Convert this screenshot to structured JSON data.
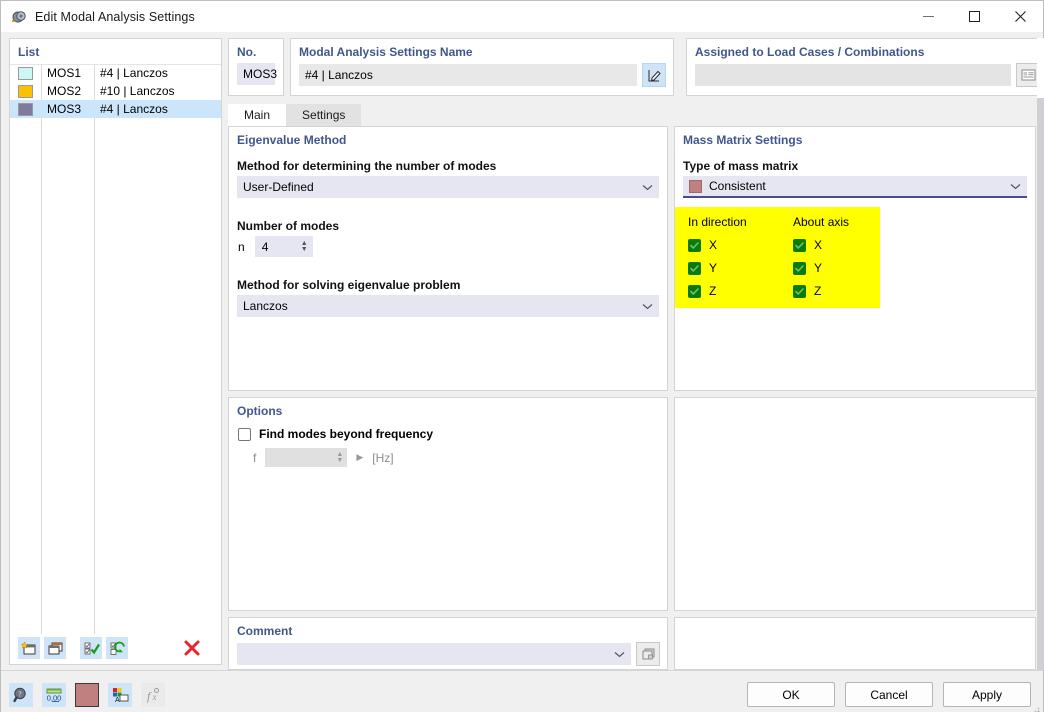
{
  "window": {
    "title": "Edit Modal Analysis Settings",
    "icon": "modal-analysis-icon",
    "minimize": "—",
    "maximize": "□",
    "close": "✕"
  },
  "list_panel": {
    "title": "List",
    "columns": [
      "color",
      "no",
      "description"
    ],
    "rows": [
      {
        "color": "#cdf6f7",
        "no": "MOS1",
        "description": "#4 | Lanczos",
        "selected": false
      },
      {
        "color": "#fbc002",
        "no": "MOS2",
        "description": "#10 | Lanczos",
        "selected": false
      },
      {
        "color": "#7f7a9e",
        "no": "MOS3",
        "description": "#4 | Lanczos",
        "selected": true
      }
    ],
    "toolbar": [
      {
        "name": "new-item-button",
        "title": "New"
      },
      {
        "name": "copy-item-button",
        "title": "Copy"
      },
      {
        "name": "select-all-button",
        "title": "Select All"
      },
      {
        "name": "invert-selection-button",
        "title": "Invert Selection"
      },
      {
        "name": "delete-item-button",
        "title": "Delete"
      }
    ]
  },
  "header": {
    "no_label": "No.",
    "no_value": "MOS3",
    "name_label": "Modal Analysis Settings Name",
    "name_value": "#4 | Lanczos",
    "name_edit_button": "edit-name-icon",
    "assigned_label": "Assigned to Load Cases / Combinations",
    "assigned_value": "",
    "assigned_button": "list-picker-icon"
  },
  "tabs": [
    {
      "label": "Main",
      "active": true
    },
    {
      "label": "Settings",
      "active": false
    }
  ],
  "eigenvalue_method": {
    "title": "Eigenvalue Method",
    "method_modes_label": "Method for determining the number of modes",
    "method_modes_value": "User-Defined",
    "number_of_modes_label": "Number of modes",
    "n_label": "n",
    "n_value": "4",
    "solver_label": "Method for solving eigenvalue problem",
    "solver_value": "Lanczos"
  },
  "mass_matrix": {
    "title": "Mass Matrix Settings",
    "type_label": "Type of mass matrix",
    "type_value": "Consistent",
    "type_color": "#c08080",
    "highlight_color": "#ffff00",
    "in_direction_label": "In direction",
    "about_axis_label": "About axis",
    "in_direction": [
      {
        "label": "X",
        "checked": true
      },
      {
        "label": "Y",
        "checked": true
      },
      {
        "label": "Z",
        "checked": true
      }
    ],
    "about_axis": [
      {
        "label": "X",
        "checked": true
      },
      {
        "label": "Y",
        "checked": true
      },
      {
        "label": "Z",
        "checked": true
      }
    ],
    "checkbox_color": "#0a7a0a"
  },
  "options": {
    "title": "Options",
    "find_modes_label": "Find modes beyond frequency",
    "find_modes_checked": false,
    "f_label": "f",
    "f_value": "",
    "f_unit": "[Hz]"
  },
  "comment": {
    "title": "Comment",
    "value": "",
    "picker_button": "comment-picker-icon"
  },
  "footer": {
    "tools": [
      {
        "name": "find-button",
        "title": "Find"
      },
      {
        "name": "units-button",
        "title": "Units"
      },
      {
        "name": "color-button",
        "title": "Color"
      },
      {
        "name": "display-properties-button",
        "title": "Display Properties"
      },
      {
        "name": "formula-button",
        "title": "Formula"
      }
    ],
    "ok_label": "OK",
    "cancel_label": "Cancel",
    "apply_label": "Apply"
  },
  "colors": {
    "section_title": "#41578c",
    "window_bg": "#f0f0f0",
    "field_bg": "#e6e6f2",
    "selection": "#cbe5fb",
    "accent_underline": "#4a4a8c"
  }
}
